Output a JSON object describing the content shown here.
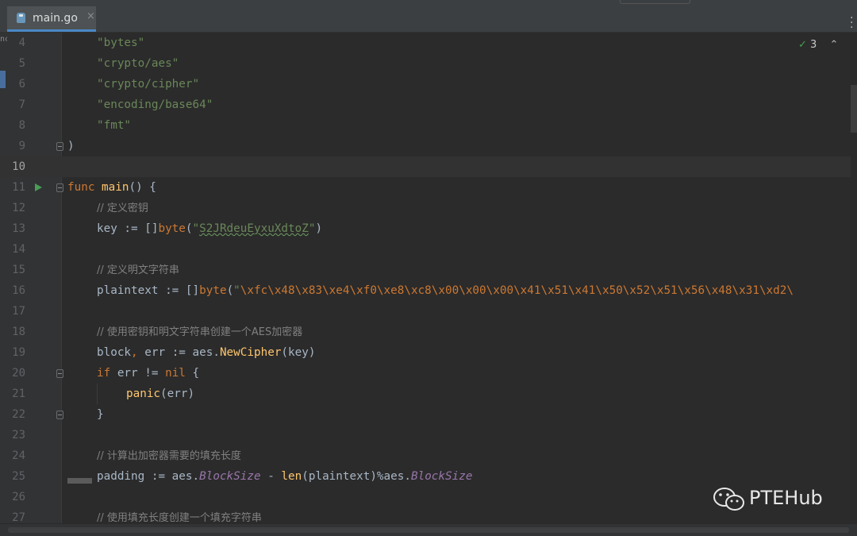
{
  "tab": {
    "filename": "main.go",
    "close": "×"
  },
  "left_strip_text": "nc",
  "inspections": {
    "count": "3"
  },
  "lines": [
    {
      "num": "4",
      "code": [
        [
          "str",
          "\"bytes\""
        ]
      ],
      "indent": 1
    },
    {
      "num": "5",
      "code": [
        [
          "str",
          "\"crypto/aes\""
        ]
      ],
      "indent": 1
    },
    {
      "num": "6",
      "code": [
        [
          "str",
          "\"crypto/cipher\""
        ]
      ],
      "indent": 1
    },
    {
      "num": "7",
      "code": [
        [
          "str",
          "\"encoding/base64\""
        ]
      ],
      "indent": 1
    },
    {
      "num": "8",
      "code": [
        [
          "str",
          "\"fmt\""
        ]
      ],
      "indent": 1
    },
    {
      "num": "9",
      "code": [
        [
          "plain",
          ")"
        ]
      ],
      "indent": 0,
      "fold": true
    },
    {
      "num": "10",
      "code": [],
      "indent": 0,
      "current": true
    },
    {
      "num": "11",
      "code": [
        [
          "kw",
          "func "
        ],
        [
          "fn",
          "main"
        ],
        [
          "plain",
          "() {"
        ]
      ],
      "indent": 0,
      "fold": true,
      "run": true
    },
    {
      "num": "12",
      "code": [
        [
          "cm",
          "// 定义密钥"
        ]
      ],
      "indent": 1
    },
    {
      "num": "13",
      "code": [
        [
          "plain",
          "key := []"
        ],
        [
          "kw",
          "byte"
        ],
        [
          "plain",
          "("
        ],
        [
          "str",
          "\""
        ],
        [
          "wavy",
          "S2JRdeuEyxuXdtoZ"
        ],
        [
          "str",
          "\""
        ],
        [
          "plain",
          ")"
        ]
      ],
      "indent": 1
    },
    {
      "num": "14",
      "code": [],
      "indent": 0
    },
    {
      "num": "15",
      "code": [
        [
          "cm",
          "// 定义明文字符串"
        ]
      ],
      "indent": 1
    },
    {
      "num": "16",
      "code": [
        [
          "plain",
          "plaintext := []"
        ],
        [
          "kw",
          "byte"
        ],
        [
          "plain",
          "("
        ],
        [
          "str",
          "\""
        ],
        [
          "esc",
          "\\xfc\\x48\\x83\\xe4\\xf0\\xe8\\xc8\\x00\\x00\\x00\\x41\\x51\\x41\\x50\\x52\\x51\\x56\\x48\\x31\\xd2\\"
        ]
      ],
      "indent": 1
    },
    {
      "num": "17",
      "code": [],
      "indent": 0
    },
    {
      "num": "18",
      "code": [
        [
          "cm",
          "// 使用密钥和明文字符串创建一个AES加密器"
        ]
      ],
      "indent": 1
    },
    {
      "num": "19",
      "code": [
        [
          "plain",
          "block"
        ],
        [
          "kw",
          ", "
        ],
        [
          "plain",
          "err := aes."
        ],
        [
          "fn",
          "NewCipher"
        ],
        [
          "plain",
          "(key)"
        ]
      ],
      "indent": 1
    },
    {
      "num": "20",
      "code": [
        [
          "kw",
          "if "
        ],
        [
          "plain",
          "err != "
        ],
        [
          "kw",
          "nil "
        ],
        [
          "plain",
          "{"
        ]
      ],
      "indent": 1,
      "fold": true
    },
    {
      "num": "21",
      "code": [
        [
          "fn",
          "panic"
        ],
        [
          "plain",
          "(err)"
        ]
      ],
      "indent": 2
    },
    {
      "num": "22",
      "code": [
        [
          "plain",
          "}"
        ]
      ],
      "indent": 1,
      "fold": true
    },
    {
      "num": "23",
      "code": [],
      "indent": 0
    },
    {
      "num": "24",
      "code": [
        [
          "cm",
          "// 计算出加密器需要的填充长度"
        ]
      ],
      "indent": 1
    },
    {
      "num": "25",
      "code": [
        [
          "plain",
          "padding := aes."
        ],
        [
          "field",
          "BlockSize"
        ],
        [
          "plain",
          " - "
        ],
        [
          "fn",
          "len"
        ],
        [
          "plain",
          "(plaintext)%aes."
        ],
        [
          "field",
          "BlockSize"
        ]
      ],
      "indent": 1
    },
    {
      "num": "26",
      "code": [],
      "indent": 0
    },
    {
      "num": "27",
      "code": [
        [
          "cm",
          "// 使用填充长度创建一个填充字符串"
        ]
      ],
      "indent": 1
    }
  ],
  "watermark": {
    "text": "PTEHub"
  },
  "colors": {
    "accent": "#4a88c7",
    "background": "#2b2b2b",
    "gutter": "#313335"
  }
}
